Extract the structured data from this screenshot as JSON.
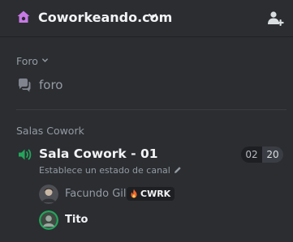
{
  "header": {
    "server_name": "Coworkeando.com",
    "icon": "home-icon",
    "invite_icon": "add-member-icon"
  },
  "sections": {
    "forum": {
      "category_label": "Foro",
      "channel_label": "foro",
      "icon": "forum-icon"
    },
    "cowork": {
      "category_label": "Salas Cowork",
      "voice_channel": {
        "label": "Sala Cowork - 01",
        "icon": "speaker-icon",
        "counter_left": "02",
        "counter_right": "20",
        "status_text": "Establece un estado de canal"
      },
      "users": [
        {
          "name": "Facundo Gil",
          "tag": "CWRK",
          "tag_icon": "flame-icon"
        },
        {
          "name": "Tito"
        }
      ]
    }
  },
  "colors": {
    "background": "#2b2d31",
    "voice_green": "#23a55a",
    "server_icon": "#c879e6",
    "muted_text": "#949ba4"
  }
}
